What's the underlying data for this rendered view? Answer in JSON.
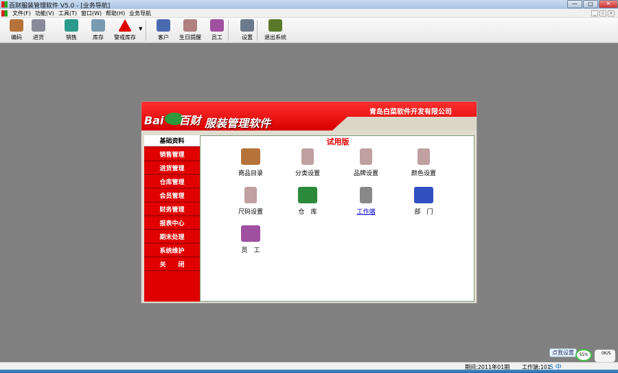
{
  "window": {
    "title": "百财服装管理软件 V5.0 - [业务导航]",
    "min": "—",
    "max": "□",
    "close": "✕"
  },
  "menu": [
    "文件(F)",
    "功能(V)",
    "工具(T)",
    "窗口(W)",
    "帮助(H)",
    "业务导航"
  ],
  "toolbar": [
    {
      "label": "编码",
      "icon": "boxes-icon",
      "color": "#b5733a"
    },
    {
      "label": "进货",
      "icon": "truck-icon",
      "color": "#8a8a9a"
    },
    {
      "label": "销售",
      "icon": "sales-icon",
      "color": "#2a9a8a"
    },
    {
      "label": "库存",
      "icon": "stock-icon",
      "color": "#7a9ab0"
    },
    {
      "label": "警戒库存",
      "icon": "warning-icon",
      "color": "#e00000"
    },
    {
      "label": "客户",
      "icon": "customer-icon",
      "color": "#4a6ab0"
    },
    {
      "label": "生日提醒",
      "icon": "birthday-icon",
      "color": "#b08080"
    },
    {
      "label": "员工",
      "icon": "staff-icon",
      "color": "#a050a0"
    },
    {
      "label": "设置",
      "icon": "settings-icon",
      "color": "#6a7a8a"
    },
    {
      "label": "退出系统",
      "icon": "exit-door-icon",
      "color": "#5a7a2a"
    }
  ],
  "panel": {
    "company": "青岛白菜软件开发有限公司",
    "logo": "Bai百财",
    "product": "服装管理软件",
    "trial": "试用版",
    "sidebar": [
      "基础资料",
      "销售管理",
      "进货管理",
      "仓库管理",
      "会员管理",
      "财务管理",
      "报表中心",
      "期末处理",
      "系统维护",
      "关　　闭"
    ],
    "items": [
      {
        "label": "商品目录",
        "icon": "boxes-icon",
        "color": "#b5733a"
      },
      {
        "label": "分类设置",
        "icon": "printer-icon",
        "color": "#c0a0a0"
      },
      {
        "label": "品牌设置",
        "icon": "printer-icon",
        "color": "#c0a0a0"
      },
      {
        "label": "颜色设置",
        "icon": "printer-icon",
        "color": "#c0a0a0"
      },
      {
        "label": "尺码设置",
        "icon": "printer-icon",
        "color": "#c0a0a0"
      },
      {
        "label": "仓　库",
        "icon": "warehouse-icon",
        "color": "#2a8a3a"
      },
      {
        "label": "工作端",
        "icon": "computer-icon",
        "color": "#888888",
        "link": true
      },
      {
        "label": "部　门",
        "icon": "department-icon",
        "color": "#3050c0"
      },
      {
        "label": "员　工",
        "icon": "staff-icon",
        "color": "#a050a0"
      }
    ]
  },
  "status": {
    "period": "期间:2011年01期",
    "workstation": "工作端:101"
  },
  "tray": {
    "tip": "点我设置",
    "gauge": "55%",
    "net": "0K/S",
    "ime": "S 中"
  }
}
